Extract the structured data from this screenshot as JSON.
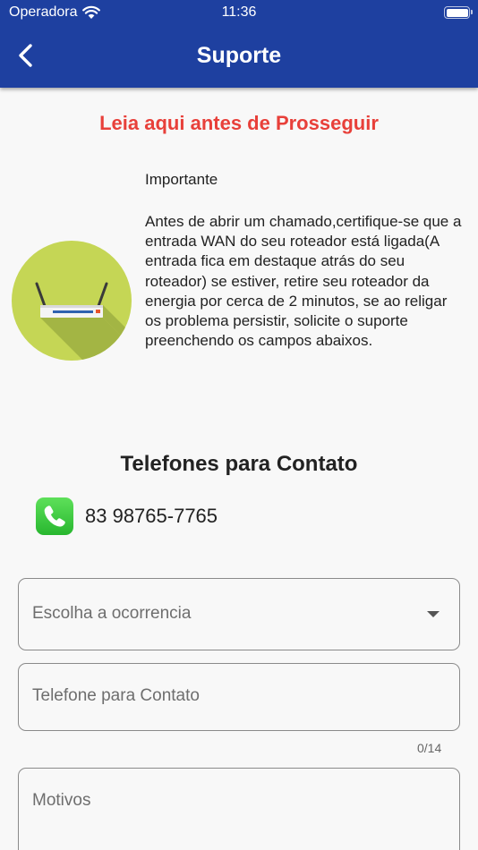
{
  "status_bar": {
    "carrier": "Operadora",
    "time": "11:36"
  },
  "nav": {
    "title": "Suporte",
    "back_icon": "chevron-left-icon"
  },
  "warning": {
    "title": "Leia aqui antes de Prosseguir",
    "color": "#e8403a"
  },
  "info": {
    "image_icon": "wifi-router-icon",
    "heading": "Importante",
    "text": "Antes de abrir um chamado,certifique-se que a entrada WAN do seu roteador está ligada(A entrada fica em destaque atrás do seu roteador) se estiver, retire seu roteador da energia por cerca de 2 minutos, se ao religar os problema persistir, solicite o suporte preenchendo os campos abaixos."
  },
  "contacts": {
    "title": "Telefones para Contato",
    "items": [
      {
        "icon": "phone-icon",
        "number": "83 98765-7765"
      }
    ]
  },
  "form": {
    "occurrence": {
      "placeholder": "Escolha a ocorrencia",
      "icon": "dropdown-arrow-icon"
    },
    "phone": {
      "placeholder": "Telefone para Contato",
      "counter": "0/14"
    },
    "reasons": {
      "placeholder": "Motivos"
    }
  },
  "colors": {
    "app_bar": "#1e40a0",
    "background": "#f8f8f8",
    "icon_circle": "#c5d655",
    "phone_icon": "#34c759"
  }
}
